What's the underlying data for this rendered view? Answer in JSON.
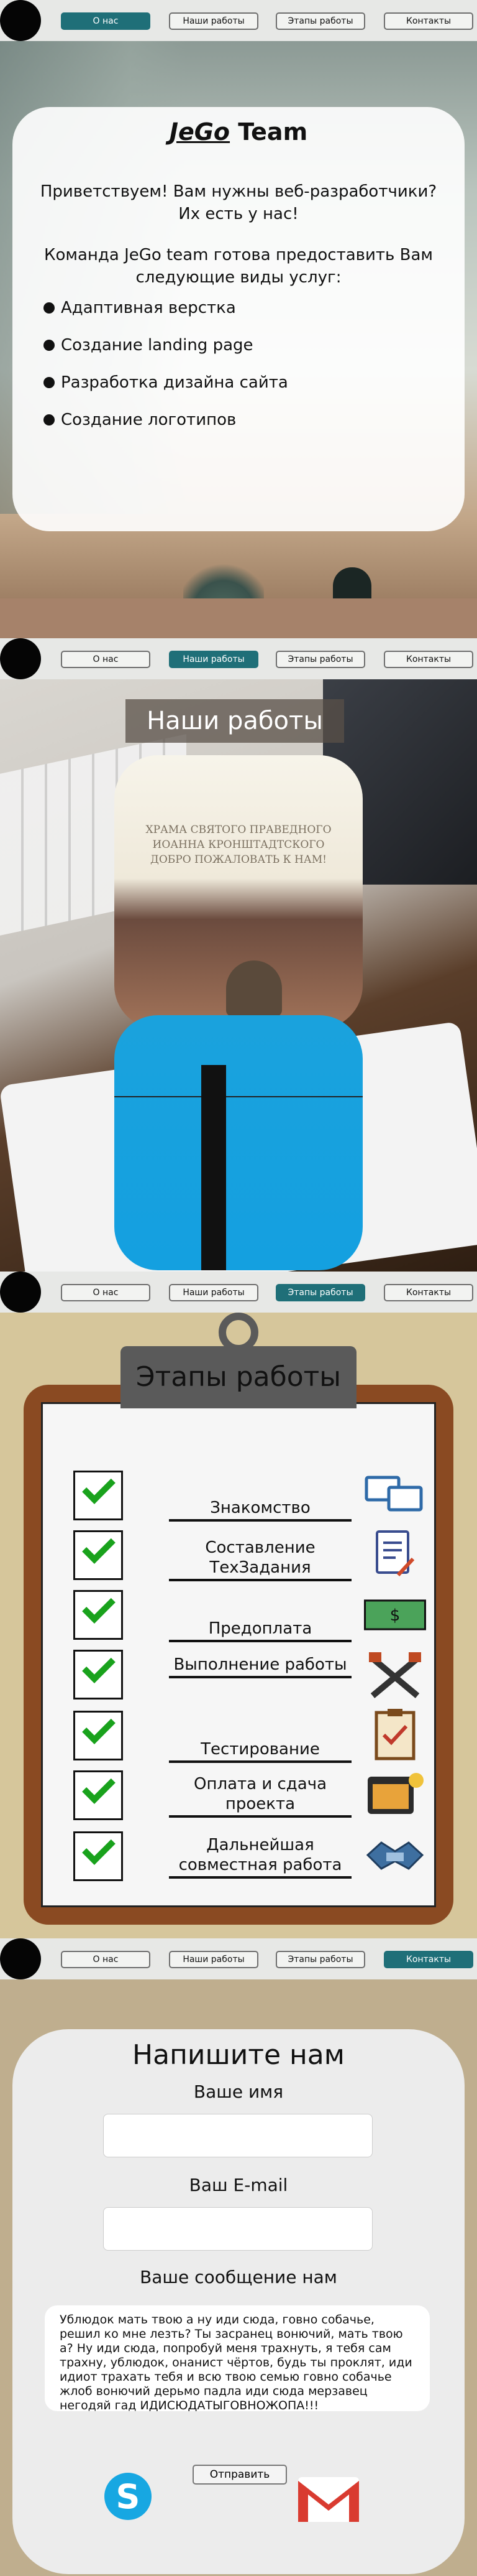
{
  "nav": {
    "items": [
      {
        "label": "О нас"
      },
      {
        "label": "Наши работы"
      },
      {
        "label": "Этапы работы"
      },
      {
        "label": "Контакты"
      }
    ],
    "active_color": "#1f6f78"
  },
  "about": {
    "title_brand": "JeGo",
    "title_rest": " Team",
    "greeting": "Приветствуем! Вам нужны веб-разработчики? Их есть у нас!",
    "intro": "Команда JeGo team готова предоставить Вам следующие виды услуг:",
    "services": [
      "Адаптивная верстка",
      "Создание landing page",
      "Разработка дизайна сайта",
      "Создание логотипов"
    ]
  },
  "works": {
    "title": "Наши работы",
    "project1_text": "ХРАМА СВЯТОГО ПРАВЕДНОГО ИОАННА КРОНШТАДТСКОГО\nДОБРО ПОЖАЛОВАТЬ К НАМ!"
  },
  "stages": {
    "title": "Этапы работы",
    "items": [
      {
        "label": "Знакомство",
        "icon": "chat-icon"
      },
      {
        "label": "Составление ТехЗадания",
        "icon": "document-icon"
      },
      {
        "label": "Предоплата",
        "icon": "dollar-icon"
      },
      {
        "label": "Выполнение работы",
        "icon": "tools-icon"
      },
      {
        "label": "Тестирование",
        "icon": "checklist-icon"
      },
      {
        "label": "Оплата и сдача проекта",
        "icon": "window-icon"
      },
      {
        "label": "Дальнейшая совместная работа",
        "icon": "handshake-icon"
      }
    ]
  },
  "contact": {
    "title": "Напишите нам",
    "name_label": "Ваше имя",
    "email_label": "Ваш E-mail",
    "message_label": "Ваше сообщение нам",
    "message_value": "Ублюдок мать твою а ну иди сюда, говно собачье, решил ко мне лезть? Ты засранец вонючий, мать твою а? Ну иди сюда, попробуй меня трахнуть, я тебя сам трахну, ублюдок, онанист чёртов, будь ты проклят, иди идиот трахать тебя и всю твою семью говно собачье жлоб вонючий дерьмо падла иди сюда мерзавец негодяй гад ИДИСЮДАТЫГОВНОЖОПА!!!",
    "send_label": "Отправить"
  }
}
